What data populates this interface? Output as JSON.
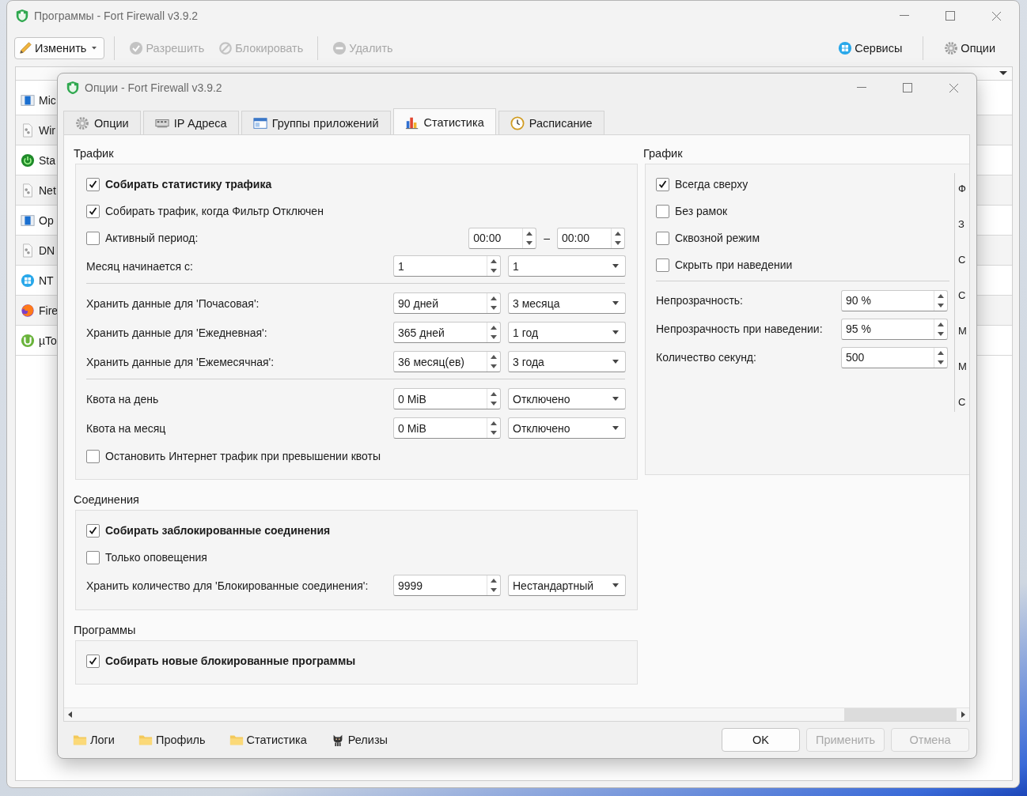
{
  "main_window": {
    "title": "Программы - Fort Firewall v3.9.2",
    "toolbar": [
      {
        "label": "Изменить",
        "kind": "menu",
        "disabled": false
      },
      {
        "label": "Разрешить",
        "kind": "allow",
        "disabled": true
      },
      {
        "label": "Блокировать",
        "kind": "block",
        "disabled": true
      },
      {
        "label": "Удалить",
        "kind": "remove",
        "disabled": true
      }
    ],
    "toolbar_right": [
      {
        "label": "Сервисы",
        "kind": "services"
      },
      {
        "label": "Опции",
        "kind": "options"
      }
    ],
    "programs": [
      {
        "name": "Mic",
        "kind": "window"
      },
      {
        "name": "Wir",
        "kind": "file"
      },
      {
        "name": "Sta",
        "kind": "power"
      },
      {
        "name": "Net",
        "kind": "file"
      },
      {
        "name": "Op",
        "kind": "window"
      },
      {
        "name": "DN",
        "kind": "file"
      },
      {
        "name": "NT",
        "kind": "windows"
      },
      {
        "name": "Fire",
        "kind": "fox"
      },
      {
        "name": "µTo",
        "kind": "torrent"
      }
    ]
  },
  "dialog": {
    "title": "Опции - Fort Firewall v3.9.2",
    "tabs": [
      {
        "label": "Опции",
        "kind": "gear",
        "selected": false
      },
      {
        "label": "IP Адреса",
        "kind": "ip",
        "selected": false
      },
      {
        "label": "Группы приложений",
        "kind": "window",
        "selected": false
      },
      {
        "label": "Статистика",
        "kind": "chart",
        "selected": true
      },
      {
        "label": "Расписание",
        "kind": "clock",
        "selected": false
      }
    ],
    "sections": [
      {
        "title": "Трафик",
        "rows": [
          {
            "kind": "check",
            "label": "Собирать статистику трафика",
            "checked": true,
            "bold": true
          },
          {
            "kind": "check",
            "label": "Собирать трафик, когда Фильтр Отключен",
            "checked": true,
            "bold": false
          },
          {
            "kind": "period",
            "label": "Активный период:",
            "checked": false,
            "from": "00:00",
            "dash": "–",
            "to": "00:00"
          },
          {
            "kind": "spin-combo",
            "label": "Месяц начинается с:",
            "value": "1",
            "option": "1"
          },
          {
            "kind": "divider"
          },
          {
            "kind": "spin-combo",
            "label": "Хранить данные для 'Почасовая':",
            "value": "90 дней",
            "option": "3 месяца"
          },
          {
            "kind": "spin-combo",
            "label": "Хранить данные для 'Ежедневная':",
            "value": "365 дней",
            "option": "1 год"
          },
          {
            "kind": "spin-combo",
            "label": "Хранить данные для 'Ежемесячная':",
            "value": "36 месяц(ев)",
            "option": "3 года"
          },
          {
            "kind": "divider"
          },
          {
            "kind": "spin-combo",
            "label": "Квота на день",
            "value": "0 MiB",
            "option": "Отключено"
          },
          {
            "kind": "spin-combo",
            "label": "Квота на месяц",
            "value": "0 MiB",
            "option": "Отключено"
          },
          {
            "kind": "check",
            "label": "Остановить Интернет трафик при превышении квоты",
            "checked": false,
            "bold": false
          }
        ]
      },
      {
        "title": "Соединения",
        "rows": [
          {
            "kind": "check",
            "label": "Собирать заблокированные соединения",
            "checked": true,
            "bold": true
          },
          {
            "kind": "check",
            "label": "Только оповещения",
            "checked": false,
            "bold": false
          },
          {
            "kind": "spin-combo",
            "label": "Хранить количество для 'Блокированные соединения':",
            "value": "9999",
            "option": "Нестандартный"
          }
        ]
      },
      {
        "title": "Программы",
        "rows": [
          {
            "kind": "check",
            "label": "Собирать новые блокированные программы",
            "checked": true,
            "bold": true
          }
        ]
      }
    ],
    "graph": {
      "title": "График",
      "rows": [
        {
          "kind": "check",
          "label": "Всегда сверху",
          "checked": true,
          "bold": false
        },
        {
          "kind": "check",
          "label": "Без рамок",
          "checked": false,
          "bold": false
        },
        {
          "kind": "check",
          "label": "Сквозной режим",
          "checked": false,
          "bold": false
        },
        {
          "kind": "check",
          "label": "Скрыть при наведении",
          "checked": false,
          "bold": false
        },
        {
          "kind": "divider"
        },
        {
          "kind": "spin",
          "label": "Непрозрачность:",
          "value": "90 %"
        },
        {
          "kind": "spin",
          "label": "Непрозрачность при наведении:",
          "value": "95 %"
        },
        {
          "kind": "spin",
          "label": "Количество секунд:",
          "value": "500"
        }
      ],
      "column_2": [
        "Ф",
        "З",
        "С",
        "С",
        "М",
        "М",
        "С"
      ]
    },
    "footer_links": [
      {
        "label": "Логи",
        "kind": "folder"
      },
      {
        "label": "Профиль",
        "kind": "folder"
      },
      {
        "label": "Статистика",
        "kind": "folder"
      },
      {
        "label": "Релизы",
        "kind": "cat"
      }
    ],
    "buttons": [
      {
        "label": "OK",
        "disabled": false
      },
      {
        "label": "Применить",
        "disabled": true
      },
      {
        "label": "Отмена",
        "disabled": true
      }
    ]
  }
}
